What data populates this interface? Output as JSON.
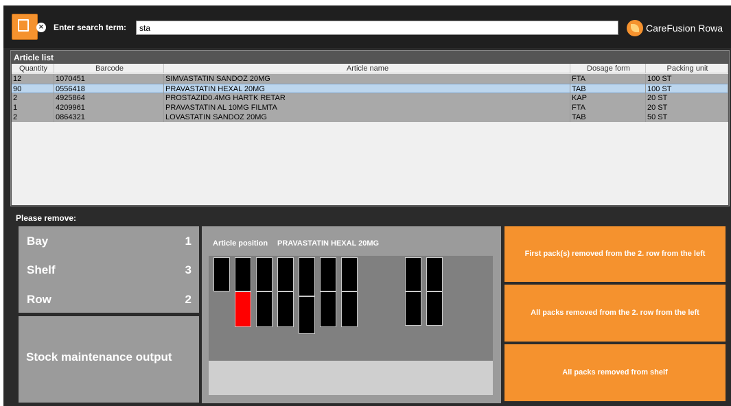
{
  "topbar": {
    "search_label": "Enter search term:",
    "search_value": "sta",
    "brand_name": "CareFusion Rowa",
    "clear_icon": "×"
  },
  "article_list": {
    "title": "Article list",
    "columns": [
      "Quantity",
      "Barcode",
      "Article name",
      "Dosage form",
      "Packing unit"
    ],
    "rows": [
      {
        "quantity": "12",
        "barcode": "1070451",
        "name": "SIMVASTATIN SANDOZ 20MG",
        "dosage": "FTA",
        "unit": "100 ST",
        "selected": false
      },
      {
        "quantity": "90",
        "barcode": "0556418",
        "name": "PRAVASTATIN HEXAL 20MG",
        "dosage": "TAB",
        "unit": "100 ST",
        "selected": true
      },
      {
        "quantity": "2",
        "barcode": "4925864",
        "name": "PROSTAZID0.4MG HARTK RETAR",
        "dosage": "KAP",
        "unit": "20 ST",
        "selected": false
      },
      {
        "quantity": "1",
        "barcode": "4209961",
        "name": "PRAVASTATIN AL 10MG FILMTA",
        "dosage": "FTA",
        "unit": "20 ST",
        "selected": false
      },
      {
        "quantity": "2",
        "barcode": "0864321",
        "name": "LOVASTATIN SANDOZ 20MG",
        "dosage": "TAB",
        "unit": "50 ST",
        "selected": false
      }
    ]
  },
  "remove": {
    "title": "Please remove:",
    "location": [
      {
        "label": "Bay",
        "value": "1"
      },
      {
        "label": "Shelf",
        "value": "3"
      },
      {
        "label": "Row",
        "value": "2"
      }
    ],
    "stock_button": "Stock maintenance output",
    "position_label": "Article position",
    "position_article": "PRAVASTATIN HEXAL 20MG",
    "actions": {
      "first": "First pack(s) removed from the 2. row from the left",
      "all_row": "All packs removed from the 2. row from the left",
      "all_shelf": "All packs removed from shelf"
    }
  },
  "colors": {
    "accent": "#f5922e",
    "panel_gray": "#9b9b9b",
    "highlight_pack": "#ff0000",
    "selected_row": "#bcd6ee"
  }
}
